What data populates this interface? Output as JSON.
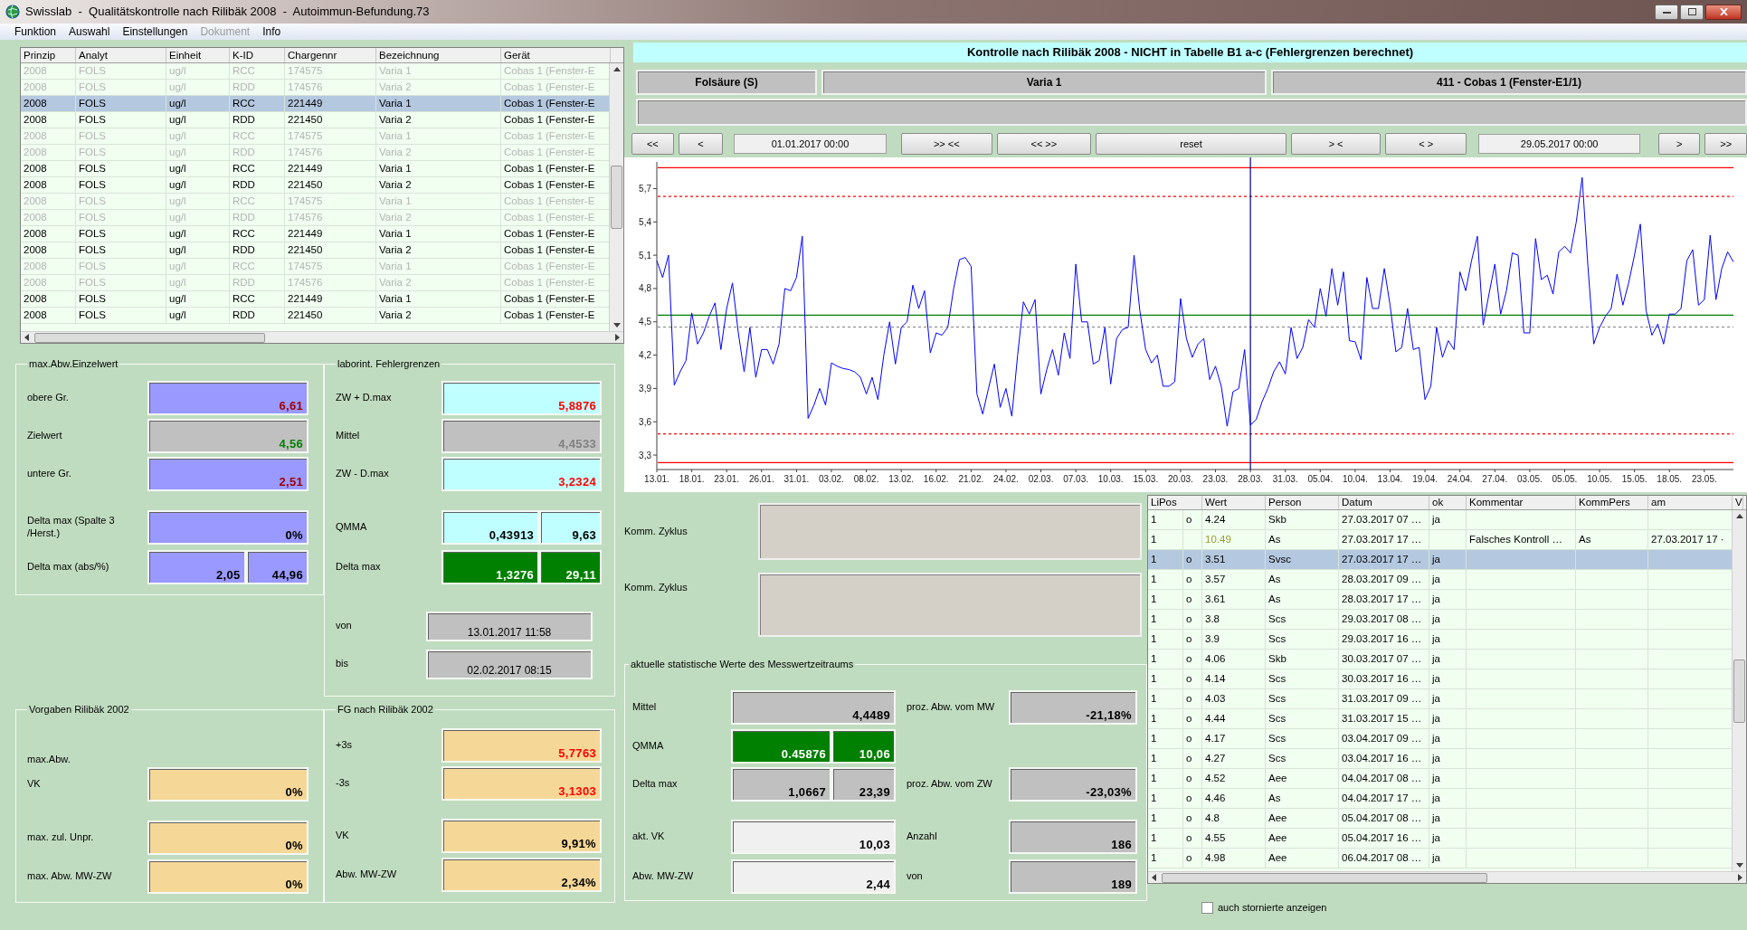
{
  "window": {
    "title": "Swisslab  -  Qualitätskontrolle nach Rilibäk 2008  -  Autoimmun-Befundung.73"
  },
  "menu": [
    {
      "label": "Funktion",
      "disabled": false
    },
    {
      "label": "Auswahl",
      "disabled": false
    },
    {
      "label": "Einstellungen",
      "disabled": false
    },
    {
      "label": "Dokument",
      "disabled": true
    },
    {
      "label": "Info",
      "disabled": false
    }
  ],
  "lot_table": {
    "columns": [
      "Prinzip",
      "Analyt",
      "Einheit",
      "K-ID",
      "Chargennr",
      "Bezeichnung",
      "Gerät"
    ],
    "rows": [
      {
        "cells": [
          "2008",
          "FOLS",
          "ug/l",
          "RCC",
          "174575",
          "Varia 1",
          "Cobas 1 (Fenster-E"
        ],
        "inactive": true,
        "selected": false
      },
      {
        "cells": [
          "2008",
          "FOLS",
          "ug/l",
          "RDD",
          "174576",
          "Varia 2",
          "Cobas 1 (Fenster-E"
        ],
        "inactive": true,
        "selected": false
      },
      {
        "cells": [
          "2008",
          "FOLS",
          "ug/l",
          "RCC",
          "221449",
          "Varia 1",
          "Cobas 1 (Fenster-E"
        ],
        "inactive": false,
        "selected": true
      },
      {
        "cells": [
          "2008",
          "FOLS",
          "ug/l",
          "RDD",
          "221450",
          "Varia 2",
          "Cobas 1 (Fenster-E"
        ],
        "inactive": false,
        "selected": false
      },
      {
        "cells": [
          "2008",
          "FOLS",
          "ug/l",
          "RCC",
          "174575",
          "Varia 1",
          "Cobas 1 (Fenster-E"
        ],
        "inactive": true,
        "selected": false
      },
      {
        "cells": [
          "2008",
          "FOLS",
          "ug/l",
          "RDD",
          "174576",
          "Varia 2",
          "Cobas 1 (Fenster-E"
        ],
        "inactive": true,
        "selected": false
      },
      {
        "cells": [
          "2008",
          "FOLS",
          "ug/l",
          "RCC",
          "221449",
          "Varia 1",
          "Cobas 1 (Fenster-E"
        ],
        "inactive": false,
        "selected": false
      },
      {
        "cells": [
          "2008",
          "FOLS",
          "ug/l",
          "RDD",
          "221450",
          "Varia 2",
          "Cobas 1 (Fenster-E"
        ],
        "inactive": false,
        "selected": false
      },
      {
        "cells": [
          "2008",
          "FOLS",
          "ug/l",
          "RCC",
          "174575",
          "Varia 1",
          "Cobas 1 (Fenster-E"
        ],
        "inactive": true,
        "selected": false
      },
      {
        "cells": [
          "2008",
          "FOLS",
          "ug/l",
          "RDD",
          "174576",
          "Varia 2",
          "Cobas 1 (Fenster-E"
        ],
        "inactive": true,
        "selected": false
      },
      {
        "cells": [
          "2008",
          "FOLS",
          "ug/l",
          "RCC",
          "221449",
          "Varia 1",
          "Cobas 1 (Fenster-E"
        ],
        "inactive": false,
        "selected": false
      },
      {
        "cells": [
          "2008",
          "FOLS",
          "ug/l",
          "RDD",
          "221450",
          "Varia 2",
          "Cobas 1 (Fenster-E"
        ],
        "inactive": false,
        "selected": false
      },
      {
        "cells": [
          "2008",
          "FOLS",
          "ug/l",
          "RCC",
          "174575",
          "Varia 1",
          "Cobas 1 (Fenster-E"
        ],
        "inactive": true,
        "selected": false
      },
      {
        "cells": [
          "2008",
          "FOLS",
          "ug/l",
          "RDD",
          "174576",
          "Varia 2",
          "Cobas 1 (Fenster-E"
        ],
        "inactive": true,
        "selected": false
      },
      {
        "cells": [
          "2008",
          "FOLS",
          "ug/l",
          "RCC",
          "221449",
          "Varia 1",
          "Cobas 1 (Fenster-E"
        ],
        "inactive": false,
        "selected": false
      },
      {
        "cells": [
          "2008",
          "FOLS",
          "ug/l",
          "RDD",
          "221450",
          "Varia 2",
          "Cobas 1 (Fenster-E"
        ],
        "inactive": false,
        "selected": false
      }
    ]
  },
  "left_panels": {
    "groups": [
      {
        "title": "max.Abw.Einzelwert",
        "rows": [
          {
            "label": "obere Gr.",
            "values": [
              {
                "text": "6,61",
                "kind": "spec",
                "color": "#a00000"
              }
            ]
          },
          {
            "label": "Zielwert",
            "values": [
              {
                "text": "4,56",
                "kind": "neutral",
                "color": "#008000"
              }
            ]
          },
          {
            "label": "untere Gr.",
            "values": [
              {
                "text": "2,51",
                "kind": "spec",
                "color": "#a00000"
              }
            ]
          },
          {
            "label": "Delta max (Spalte 3 /Herst.)",
            "values": [
              {
                "text": "0%",
                "kind": "spec"
              }
            ]
          },
          {
            "label": "Delta max (abs/%)",
            "values": [
              {
                "text": "2,05",
                "kind": "spec"
              },
              {
                "text": "44,96",
                "kind": "spec"
              }
            ]
          }
        ]
      },
      {
        "title": "laborint. Fehlergrenzen",
        "rows": [
          {
            "label": "ZW + D.max",
            "values": [
              {
                "text": "5,8876",
                "kind": "lab",
                "color": "#ff0000"
              }
            ]
          },
          {
            "label": "Mittel",
            "values": [
              {
                "text": "4,4533",
                "kind": "neutral",
                "color": "#808080"
              }
            ]
          },
          {
            "label": "ZW - D.max",
            "values": [
              {
                "text": "3,2324",
                "kind": "lab",
                "color": "#ff0000"
              }
            ]
          },
          {
            "label": "QMMA",
            "values": [
              {
                "text": "0,43913",
                "kind": "lab"
              },
              {
                "text": "9,63",
                "kind": "lab"
              }
            ]
          },
          {
            "label": "Delta max",
            "values": [
              {
                "text": "1,3276",
                "kind": "pass"
              },
              {
                "text": "29,11",
                "kind": "pass"
              }
            ]
          },
          {
            "label": "von",
            "values": [
              {
                "text": "13.01.2017 11:58",
                "kind": "date"
              }
            ]
          },
          {
            "label": "bis",
            "values": [
              {
                "text": "02.02.2017 08:15",
                "kind": "date"
              }
            ]
          }
        ]
      },
      {
        "title": "Vorgaben Rilibäk 2002",
        "rows": [
          {
            "label": "max.Abw."
          },
          {
            "label": "VK",
            "values": [
              {
                "text": "0%",
                "kind": "rili"
              }
            ]
          },
          {
            "label": "max. zul. Unpr.",
            "values": [
              {
                "text": "0%",
                "kind": "rili"
              }
            ]
          },
          {
            "label": "max. Abw. MW-ZW",
            "values": [
              {
                "text": "0%",
                "kind": "rili"
              }
            ]
          }
        ]
      },
      {
        "title": "FG nach Rilibäk 2002",
        "rows": [
          {
            "label": "+3s",
            "values": [
              {
                "text": "5,7763",
                "kind": "rili",
                "color": "#ff0000"
              }
            ]
          },
          {
            "label": "-3s",
            "values": [
              {
                "text": "3,1303",
                "kind": "rili",
                "color": "#ff0000"
              }
            ]
          },
          {
            "label": "VK",
            "values": [
              {
                "text": "9,91%",
                "kind": "rili"
              }
            ]
          },
          {
            "label": "Abw. MW-ZW",
            "values": [
              {
                "text": "2,34%",
                "kind": "rili"
              }
            ]
          }
        ]
      }
    ]
  },
  "chart_panel": {
    "title": "Kontrolle nach Rilibäk 2008 - NICHT in Tabelle B1 a-c (Fehlergrenzen berechnet)",
    "info": [
      "Folsäure (S)",
      "Varia 1",
      "411 - Cobas 1 (Fenster-E1/1)"
    ],
    "nav": [
      {
        "kind": "button",
        "label": "<<"
      },
      {
        "kind": "button",
        "label": "<"
      },
      {
        "kind": "field",
        "value": "01.01.2017 00:00"
      },
      {
        "kind": "button",
        "label": ">> <<"
      },
      {
        "kind": "button",
        "label": "<< >>"
      },
      {
        "kind": "button",
        "label": "reset"
      },
      {
        "kind": "button",
        "label": "> <"
      },
      {
        "kind": "button",
        "label": "< >"
      },
      {
        "kind": "field",
        "value": "29.05.2017 00:00"
      },
      {
        "kind": "button",
        "label": ">"
      },
      {
        "kind": "button",
        "label": ">>"
      }
    ],
    "chart_data": {
      "type": "line",
      "categories": [
        "13.01.",
        null,
        null,
        null,
        null,
        null,
        "18.01.",
        null,
        null,
        null,
        null,
        null,
        "23.01.",
        null,
        null,
        null,
        null,
        null,
        "26.01.",
        null,
        null,
        null,
        null,
        null,
        "31.01.",
        null,
        null,
        null,
        null,
        null,
        "03.02.",
        null,
        null,
        null,
        null,
        null,
        "08.02.",
        null,
        null,
        null,
        null,
        null,
        "13.02.",
        null,
        null,
        null,
        null,
        null,
        "16.02.",
        null,
        null,
        null,
        null,
        null,
        "21.02.",
        null,
        null,
        null,
        null,
        null,
        "24.02.",
        null,
        null,
        null,
        null,
        null,
        "02.03.",
        null,
        null,
        null,
        null,
        null,
        "07.03.",
        null,
        null,
        null,
        null,
        null,
        "10.03.",
        null,
        null,
        null,
        null,
        null,
        "15.03.",
        null,
        null,
        null,
        null,
        null,
        "20.03.",
        null,
        null,
        null,
        null,
        null,
        "23.03.",
        null,
        null,
        null,
        null,
        null,
        "28.03.",
        null,
        null,
        null,
        null,
        null,
        "31.03.",
        null,
        null,
        null,
        null,
        null,
        "05.04.",
        null,
        null,
        null,
        null,
        null,
        "10.04.",
        null,
        null,
        null,
        null,
        null,
        "13.04.",
        null,
        null,
        null,
        null,
        null,
        "19.04.",
        null,
        null,
        null,
        null,
        null,
        "24.04.",
        null,
        null,
        null,
        null,
        null,
        "27.04.",
        null,
        null,
        null,
        null,
        null,
        "03.05.",
        null,
        null,
        null,
        null,
        null,
        "05.05.",
        null,
        null,
        null,
        null,
        null,
        "10.05.",
        null,
        null,
        null,
        null,
        null,
        "15.05.",
        null,
        null,
        null,
        null,
        null,
        "18.05.",
        null,
        null,
        null,
        null,
        null,
        "23.05.",
        null,
        null,
        null,
        null,
        null
      ],
      "ylim": [
        3.17,
        5.94
      ],
      "yticks": [
        {
          "value": 3.3,
          "label": "3,3"
        },
        {
          "value": 3.6,
          "label": "3,6"
        },
        {
          "value": 3.9,
          "label": "3,9"
        },
        {
          "value": 4.2,
          "label": "4,2"
        },
        {
          "value": 4.5,
          "label": "4,5"
        },
        {
          "value": 4.8,
          "label": "4,8"
        },
        {
          "value": 5.1,
          "label": "5,1"
        },
        {
          "value": 5.4,
          "label": "5,4"
        },
        {
          "value": 5.7,
          "label": "5,7"
        }
      ],
      "series": [
        {
          "color": "#0000ff",
          "values": [
            5.05,
            4.9,
            5.1,
            3.93,
            4.05,
            4.15,
            4.58,
            4.3,
            4.4,
            4.55,
            4.67,
            4.25,
            4.62,
            4.85,
            4.4,
            4.05,
            4.45,
            4.0,
            4.25,
            4.25,
            4.12,
            4.3,
            4.8,
            4.78,
            4.9,
            5.27,
            3.63,
            3.75,
            3.9,
            3.75,
            4.13,
            4.1,
            4.08,
            4.07,
            4.05,
            4.0,
            3.85,
            4.0,
            3.8,
            4.2,
            4.5,
            4.12,
            4.45,
            4.5,
            4.83,
            4.62,
            4.78,
            4.22,
            4.4,
            4.38,
            4.45,
            4.8,
            5.06,
            5.08,
            5.0,
            3.85,
            3.67,
            3.9,
            4.12,
            3.73,
            3.9,
            3.65,
            4.2,
            4.68,
            4.57,
            4.7,
            3.85,
            4.07,
            4.25,
            4.02,
            4.4,
            4.17,
            5.02,
            4.5,
            4.5,
            4.12,
            4.15,
            4.45,
            3.94,
            4.35,
            4.43,
            4.45,
            5.1,
            4.6,
            4.25,
            4.13,
            4.2,
            3.92,
            3.92,
            3.96,
            4.71,
            4.35,
            4.18,
            4.3,
            4.35,
            3.98,
            4.1,
            3.92,
            3.56,
            3.87,
            3.9,
            4.25,
            3.57,
            3.62,
            3.78,
            3.9,
            4.05,
            4.14,
            4.03,
            4.45,
            4.17,
            4.27,
            4.52,
            4.45,
            4.8,
            4.55,
            4.98,
            4.65,
            4.95,
            4.33,
            4.32,
            4.16,
            4.9,
            4.62,
            4.62,
            4.98,
            4.65,
            4.23,
            4.27,
            4.62,
            4.25,
            4.27,
            3.8,
            3.92,
            4.45,
            4.18,
            4.33,
            4.25,
            4.95,
            4.78,
            5.05,
            5.27,
            4.47,
            4.75,
            5.02,
            4.57,
            4.78,
            5.12,
            5.1,
            4.4,
            4.4,
            5.25,
            4.88,
            4.92,
            4.75,
            5.13,
            5.18,
            5.12,
            5.4,
            5.8,
            5.0,
            4.3,
            4.45,
            4.55,
            4.62,
            4.93,
            4.65,
            4.85,
            5.1,
            5.38,
            4.6,
            4.38,
            4.48,
            4.3,
            4.57,
            4.57,
            4.62,
            5.05,
            5.15,
            4.65,
            4.7,
            5.28,
            4.7,
            4.98,
            5.13,
            5.04
          ]
        }
      ],
      "ref_lines": [
        {
          "axis": "y",
          "value": 5.8876,
          "color": "#ff0000"
        },
        {
          "axis": "y",
          "value": 5.63,
          "color": "#ff0000"
        },
        {
          "axis": "y",
          "value": 4.56,
          "color": "#008000"
        },
        {
          "axis": "y",
          "value": 4.4533,
          "color": "#808080"
        },
        {
          "axis": "y",
          "value": 3.49,
          "color": "#ff0000"
        },
        {
          "axis": "y",
          "value": 3.2324,
          "color": "#ff0000"
        }
      ]
    }
  },
  "comments": [
    {
      "label": "Komm. Zyklus"
    },
    {
      "label": "Komm. Zyklus"
    }
  ],
  "stats": {
    "title": "aktuelle statistische Werte des Messwertzeitraums",
    "rows": [
      {
        "label": "Mittel",
        "values": [
          {
            "text": "4,4489",
            "kind": "neutral"
          }
        ],
        "side": {
          "label": "proz. Abw. vom MW",
          "values": [
            {
              "text": "-21,18%",
              "kind": "neutral"
            }
          ]
        }
      },
      {
        "label": "QMMA",
        "values": [
          {
            "text": "0.45876",
            "kind": "pass"
          },
          {
            "text": "10,06",
            "kind": "pass"
          }
        ]
      },
      {
        "label": "Delta max",
        "values": [
          {
            "text": "1,0667",
            "kind": "neutral"
          },
          {
            "text": "23,39",
            "kind": "neutral"
          }
        ],
        "side": {
          "label": "proz. Abw. vom ZW",
          "values": [
            {
              "text": "-23,03%",
              "kind": "neutral"
            }
          ]
        }
      },
      {
        "label": "akt. VK",
        "values": [
          {
            "text": "10,03",
            "kind": "input"
          }
        ],
        "side": {
          "label": "Anzahl",
          "values": [
            {
              "text": "186",
              "kind": "neutral"
            }
          ]
        }
      },
      {
        "label": "Abw. MW-ZW",
        "values": [
          {
            "text": "2,44",
            "kind": "input"
          }
        ],
        "side": {
          "label": "von",
          "values": [
            {
              "text": "189",
              "kind": "neutral"
            }
          ]
        }
      }
    ]
  },
  "measurements": {
    "columns": [
      "LiPos",
      "Wert",
      "Person",
      "Datum",
      "ok",
      "Kommentar",
      "KommPers",
      "am",
      "V"
    ],
    "rows": [
      {
        "lipos": "1",
        "mark": "o",
        "wert": "4.24",
        "person": "Skb",
        "datum": "27.03.2017 07 …",
        "ok": "ja",
        "rejected": false,
        "selected": false
      },
      {
        "lipos": "1",
        "wert": "10.49",
        "person": "As",
        "datum": "27.03.2017 17 …",
        "kommentar": "Falsches Kontroll …",
        "kommpers": "As",
        "am": "27.03.2017 17 ·",
        "rejected": true,
        "selected": false
      },
      {
        "lipos": "1",
        "mark": "o",
        "wert": "3.51",
        "person": "Svsc",
        "datum": "27.03.2017 17 …",
        "ok": "ja",
        "rejected": false,
        "selected": true
      },
      {
        "lipos": "1",
        "mark": "o",
        "wert": "3.57",
        "person": "As",
        "datum": "28.03.2017 09 …",
        "ok": "ja",
        "rejected": false,
        "selected": false
      },
      {
        "lipos": "1",
        "mark": "o",
        "wert": "3.61",
        "person": "As",
        "datum": "28.03.2017 17 …",
        "ok": "ja",
        "rejected": false,
        "selected": false
      },
      {
        "lipos": "1",
        "mark": "o",
        "wert": "3.8",
        "person": "Scs",
        "datum": "29.03.2017 08 …",
        "ok": "ja",
        "rejected": false,
        "selected": false
      },
      {
        "lipos": "1",
        "mark": "o",
        "wert": "3.9",
        "person": "Scs",
        "datum": "29.03.2017 16 …",
        "ok": "ja",
        "rejected": false,
        "selected": false
      },
      {
        "lipos": "1",
        "mark": "o",
        "wert": "4.06",
        "person": "Skb",
        "datum": "30.03.2017 07 …",
        "ok": "ja",
        "rejected": false,
        "selected": false
      },
      {
        "lipos": "1",
        "mark": "o",
        "wert": "4.14",
        "person": "Scs",
        "datum": "30.03.2017 16 …",
        "ok": "ja",
        "rejected": false,
        "selected": false
      },
      {
        "lipos": "1",
        "mark": "o",
        "wert": "4.03",
        "person": "Scs",
        "datum": "31.03.2017 09 …",
        "ok": "ja",
        "rejected": false,
        "selected": false
      },
      {
        "lipos": "1",
        "mark": "o",
        "wert": "4.44",
        "person": "Scs",
        "datum": "31.03.2017 15 …",
        "ok": "ja",
        "rejected": false,
        "selected": false
      },
      {
        "lipos": "1",
        "mark": "o",
        "wert": "4.17",
        "person": "Scs",
        "datum": "03.04.2017 09 …",
        "ok": "ja",
        "rejected": false,
        "selected": false
      },
      {
        "lipos": "1",
        "mark": "o",
        "wert": "4.27",
        "person": "Scs",
        "datum": "03.04.2017 16 …",
        "ok": "ja",
        "rejected": false,
        "selected": false
      },
      {
        "lipos": "1",
        "mark": "o",
        "wert": "4.52",
        "person": "Aee",
        "datum": "04.04.2017 08 …",
        "ok": "ja",
        "rejected": false,
        "selected": false
      },
      {
        "lipos": "1",
        "mark": "o",
        "wert": "4.46",
        "person": "As",
        "datum": "04.04.2017 17 …",
        "ok": "ja",
        "rejected": false,
        "selected": false
      },
      {
        "lipos": "1",
        "mark": "o",
        "wert": "4.8",
        "person": "Aee",
        "datum": "05.04.2017 08 …",
        "ok": "ja",
        "rejected": false,
        "selected": false
      },
      {
        "lipos": "1",
        "mark": "o",
        "wert": "4.55",
        "person": "Aee",
        "datum": "05.04.2017 16 …",
        "ok": "ja",
        "rejected": false,
        "selected": false
      },
      {
        "lipos": "1",
        "mark": "o",
        "wert": "4.98",
        "person": "Aee",
        "datum": "06.04.2017 08 …",
        "ok": "ja",
        "rejected": false,
        "selected": false
      }
    ]
  },
  "show_cancelled": {
    "label": "auch stornierte anzeigen",
    "checked": false
  }
}
